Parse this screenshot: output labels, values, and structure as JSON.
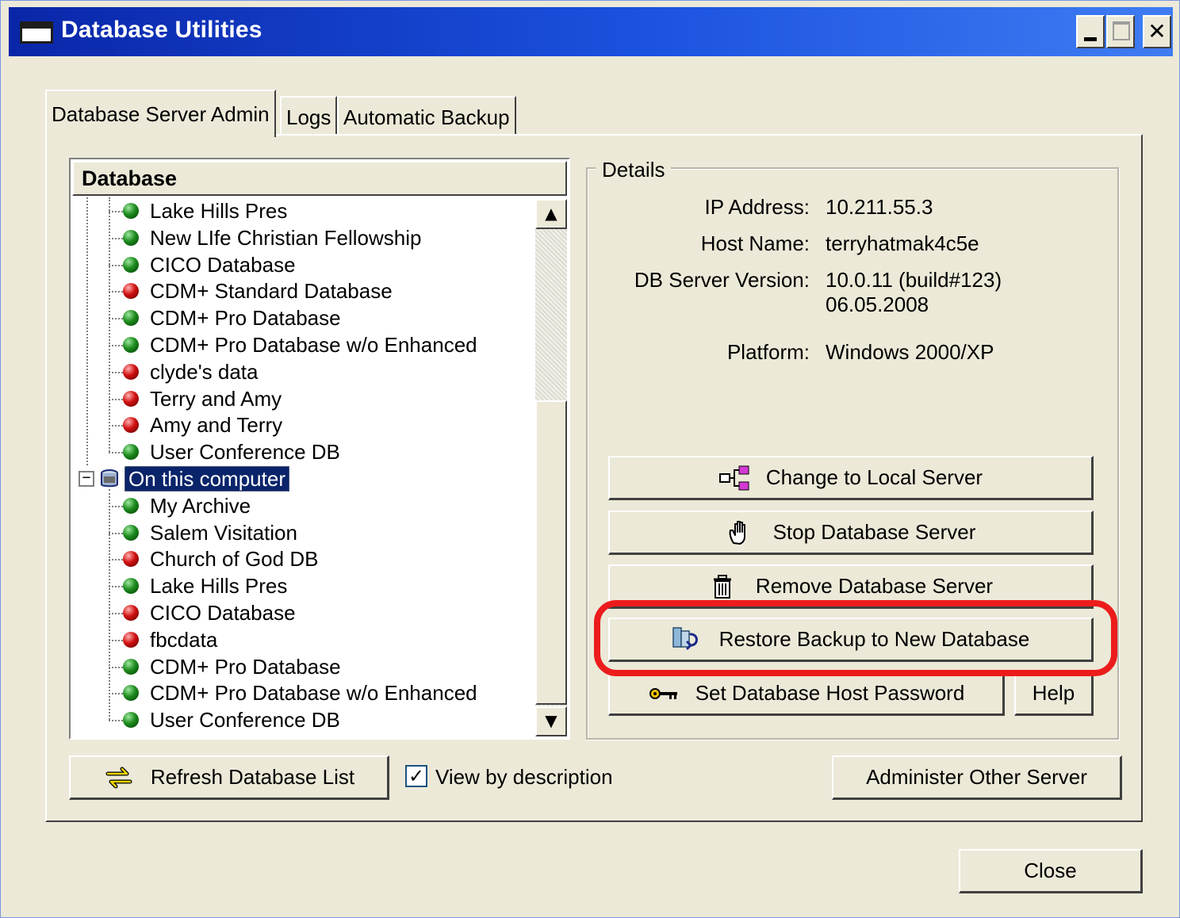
{
  "window": {
    "title": "Database Utilities"
  },
  "tabs": [
    {
      "label": "Database Server Admin",
      "active": true
    },
    {
      "label": "Logs",
      "active": false
    },
    {
      "label": "Automatic Backup",
      "active": false
    }
  ],
  "tree": {
    "header": "Database",
    "remote_items": [
      {
        "label": "Lake Hills Pres",
        "status": "green"
      },
      {
        "label": "New LIfe Christian Fellowship",
        "status": "green"
      },
      {
        "label": "CICO Database",
        "status": "green"
      },
      {
        "label": "CDM+ Standard Database",
        "status": "red"
      },
      {
        "label": "CDM+ Pro Database",
        "status": "green"
      },
      {
        "label": "CDM+ Pro Database w/o Enhanced",
        "status": "green"
      },
      {
        "label": "clyde's data",
        "status": "red"
      },
      {
        "label": "Terry and Amy",
        "status": "red"
      },
      {
        "label": "Amy and Terry",
        "status": "red"
      },
      {
        "label": "User Conference DB",
        "status": "green"
      }
    ],
    "local_node": {
      "label": "On this computer",
      "expander": "−"
    },
    "local_items": [
      {
        "label": "My Archive",
        "status": "green"
      },
      {
        "label": "Salem Visitation",
        "status": "green"
      },
      {
        "label": "Church of God DB",
        "status": "red"
      },
      {
        "label": "Lake Hills Pres",
        "status": "green"
      },
      {
        "label": "CICO Database",
        "status": "red"
      },
      {
        "label": "fbcdata",
        "status": "red"
      },
      {
        "label": "CDM+ Pro Database",
        "status": "green"
      },
      {
        "label": "CDM+ Pro Database w/o Enhanced",
        "status": "green"
      },
      {
        "label": "User Conference DB",
        "status": "green"
      }
    ],
    "scroll_up": "▲",
    "scroll_down": "▼"
  },
  "details": {
    "legend": "Details",
    "ip_label": "IP Address:",
    "ip_value": "10.211.55.3",
    "host_label": "Host Name:",
    "host_value": "terryhatmak4c5e",
    "version_label": "DB Server Version:",
    "version_value_line1": "10.0.11 (build#123)",
    "version_value_line2": "06.05.2008",
    "platform_label": "Platform:",
    "platform_value": "Windows 2000/XP"
  },
  "buttons": {
    "change_local": "Change to Local Server",
    "stop_server": "Stop Database Server",
    "remove_server": "Remove Database Server",
    "restore_backup": "Restore Backup to New Database",
    "set_password": "Set Database Host Password",
    "help": "Help",
    "refresh": "Refresh Database List",
    "administer": "Administer Other Server",
    "close": "Close"
  },
  "view_by_description": {
    "label": "View by description",
    "checked": true,
    "check_glyph": "✓"
  },
  "colors": {
    "title_bar": "#0a26a8",
    "selection": "#0a246a",
    "status_green": "#1e8c1e",
    "status_red": "#d01010",
    "highlight_ring": "#ec1c1c",
    "window_bg": "#ece9d8"
  }
}
